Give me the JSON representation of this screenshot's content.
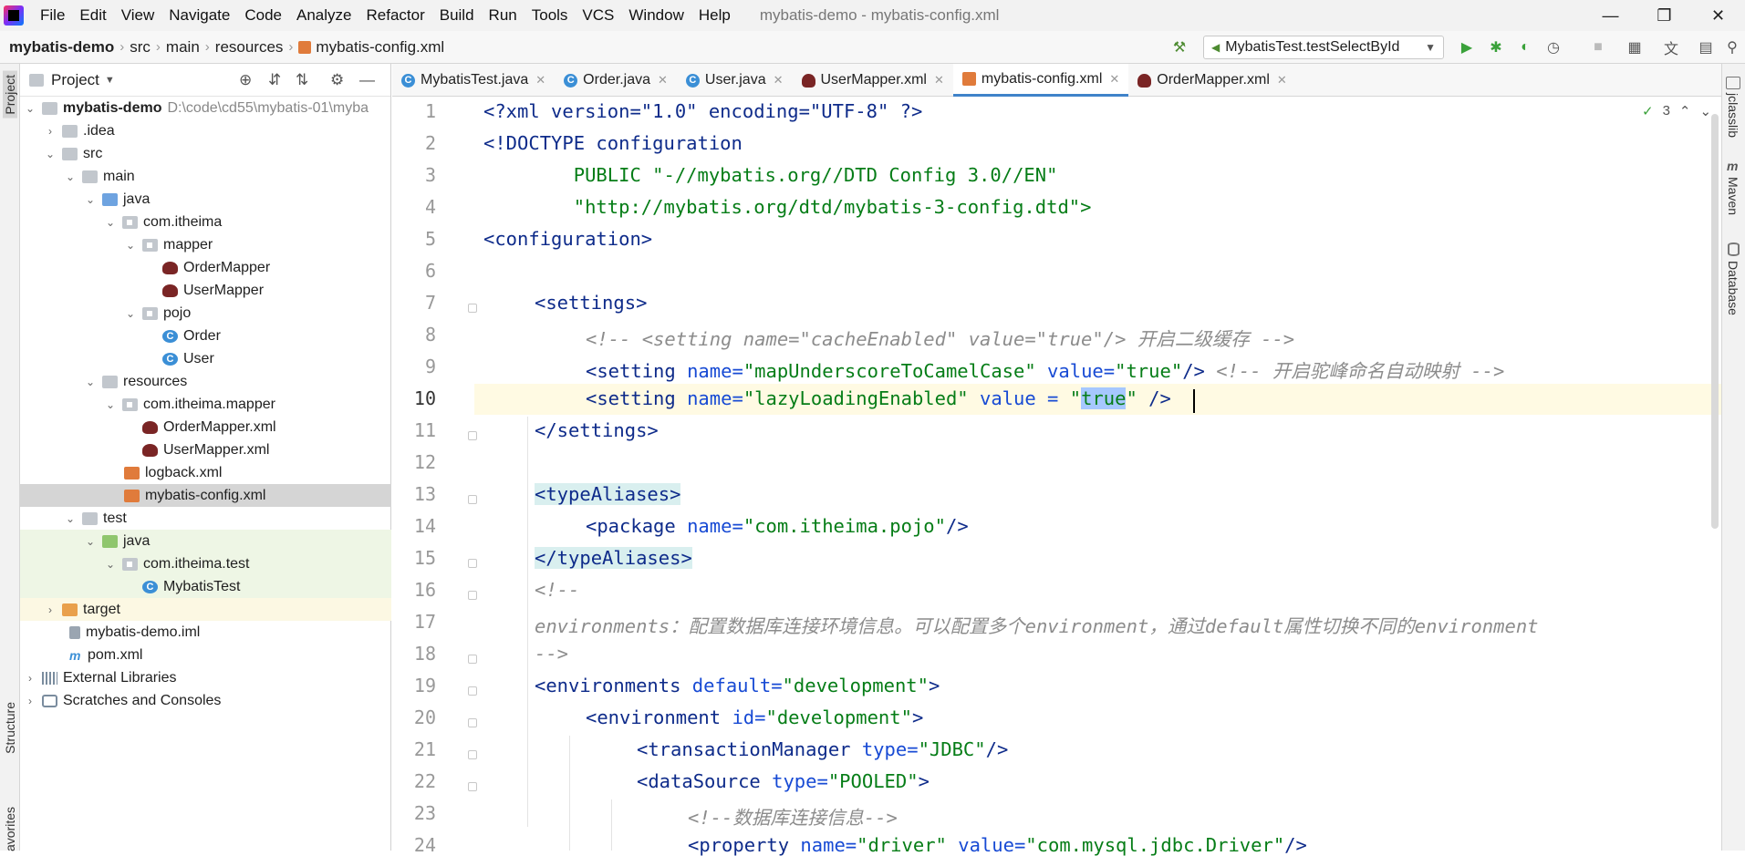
{
  "menu": [
    "File",
    "Edit",
    "View",
    "Navigate",
    "Code",
    "Analyze",
    "Refactor",
    "Build",
    "Run",
    "Tools",
    "VCS",
    "Window",
    "Help"
  ],
  "window_title": "mybatis-demo - mybatis-config.xml",
  "breadcrumb": [
    "mybatis-demo",
    "src",
    "main",
    "resources",
    "mybatis-config.xml"
  ],
  "run_config": "MybatisTest.testSelectById",
  "project_panel": {
    "title": "Project"
  },
  "left_stripe": {
    "project": "Project",
    "structure": "Structure",
    "favorites": "avorites"
  },
  "right_stripe": {
    "jclasslib": "jclasslib",
    "maven": "Maven",
    "database": "Database"
  },
  "tree": [
    {
      "label": "mybatis-demo",
      "extra": "D:\\code\\cd55\\mybatis-01\\myba",
      "bold": true
    },
    {
      "label": ".idea"
    },
    {
      "label": "src"
    },
    {
      "label": "main"
    },
    {
      "label": "java"
    },
    {
      "label": "com.itheima"
    },
    {
      "label": "mapper"
    },
    {
      "label": "OrderMapper"
    },
    {
      "label": "UserMapper"
    },
    {
      "label": "pojo"
    },
    {
      "label": "Order"
    },
    {
      "label": "User"
    },
    {
      "label": "resources"
    },
    {
      "label": "com.itheima.mapper"
    },
    {
      "label": "OrderMapper.xml"
    },
    {
      "label": "UserMapper.xml"
    },
    {
      "label": "logback.xml"
    },
    {
      "label": "mybatis-config.xml"
    },
    {
      "label": "test"
    },
    {
      "label": "java"
    },
    {
      "label": "com.itheima.test"
    },
    {
      "label": "MybatisTest"
    },
    {
      "label": "target"
    },
    {
      "label": "mybatis-demo.iml"
    },
    {
      "label": "pom.xml"
    },
    {
      "label": "External Libraries"
    },
    {
      "label": "Scratches and Consoles"
    }
  ],
  "tabs": [
    "MybatisTest.java",
    "Order.java",
    "User.java",
    "UserMapper.xml",
    "mybatis-config.xml",
    "OrderMapper.xml"
  ],
  "inspection_count": "3",
  "line_numbers": [
    "1",
    "2",
    "3",
    "4",
    "5",
    "6",
    "7",
    "8",
    "9",
    "10",
    "11",
    "12",
    "13",
    "14",
    "15",
    "16",
    "17",
    "18",
    "19",
    "20",
    "21",
    "22",
    "23",
    "24"
  ],
  "code": {
    "l1": "<?xml version=\"1.0\" encoding=\"UTF-8\" ?>",
    "l2": "<!DOCTYPE configuration",
    "l3": "        PUBLIC \"-//mybatis.org//DTD Config 3.0//EN\"",
    "l4": "        \"http://mybatis.org/dtd/mybatis-3-config.dtd\">",
    "l5": "<configuration>",
    "l7": "<settings>",
    "l8": "<!-- <setting name=\"cacheEnabled\" value=\"true\"/> 开启二级缓存 -->",
    "l9a": "<setting ",
    "l9b": "name=",
    "l9c": "\"mapUnderscoreToCamelCase\"",
    "l9d": " value=",
    "l9e": "\"true\"",
    "l9f": "/>",
    "l9g": " <!-- 开启驼峰命名自动映射 -->",
    "l10a": "<setting ",
    "l10b": "name=",
    "l10c": "\"lazyLoadingEnabled\"",
    "l10d": " value = ",
    "l10e": "\"",
    "l10f": "true",
    "l10g": "\"",
    "l10h": " />",
    "l11": "</settings>",
    "l13": "<typeAliases>",
    "l14a": "<package ",
    "l14b": "name=",
    "l14c": "\"com.itheima.pojo\"",
    "l14d": "/>",
    "l15": "</typeAliases>",
    "l16": "<!--",
    "l17": "environments：配置数据库连接环境信息。可以配置多个environment，通过default属性切换不同的environment",
    "l18": "-->",
    "l19a": "<environments ",
    "l19b": "default=",
    "l19c": "\"development\"",
    "l19d": ">",
    "l20a": "<environment ",
    "l20b": "id=",
    "l20c": "\"development\"",
    "l20d": ">",
    "l21a": "<transactionManager ",
    "l21b": "type=",
    "l21c": "\"JDBC\"",
    "l21d": "/>",
    "l22a": "<dataSource ",
    "l22b": "type=",
    "l22c": "\"POOLED\"",
    "l22d": ">",
    "l23": "<!--数据库连接信息-->",
    "l24a": "<property ",
    "l24b": "name=",
    "l24c": "\"driver\"",
    "l24d": " value=",
    "l24e": "\"com.mysql.jdbc.Driver\"",
    "l24f": "/>"
  }
}
